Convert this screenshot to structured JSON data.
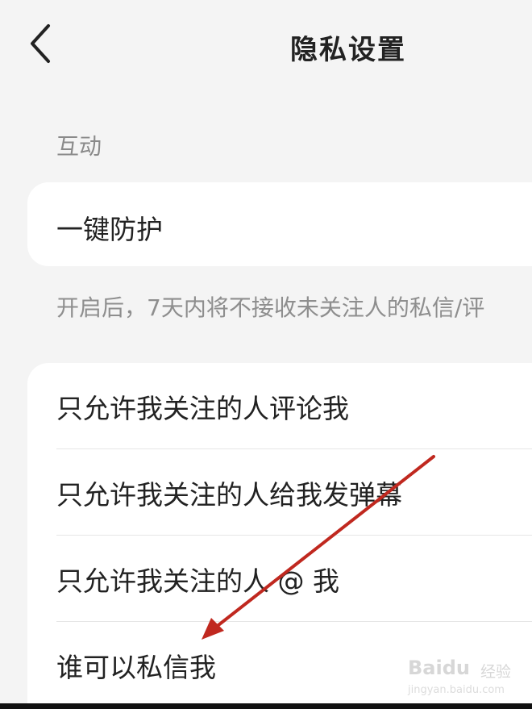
{
  "header": {
    "title": "隐私设置",
    "back_icon": "chevron-left-icon"
  },
  "interaction": {
    "section_label": "互动",
    "protect": {
      "label": "一键防护"
    },
    "hint": "开启后，7天内将不接收未关注人的私信/评"
  },
  "list": {
    "items": [
      {
        "label": "只允许我关注的人评论我"
      },
      {
        "label": "只允许我关注的人给我发弹幕"
      },
      {
        "label": "只允许我关注的人 @ 我"
      },
      {
        "label": "谁可以私信我"
      }
    ]
  },
  "annotation": {
    "arrow_color": "#c0281f"
  },
  "watermark": {
    "brand": "Baidu",
    "sub": "经验",
    "url": "jingyan.baidu.com"
  },
  "colors": {
    "background": "#f4f4f4",
    "card": "#ffffff",
    "text_primary": "#222222",
    "text_secondary": "#8a8a8a"
  }
}
